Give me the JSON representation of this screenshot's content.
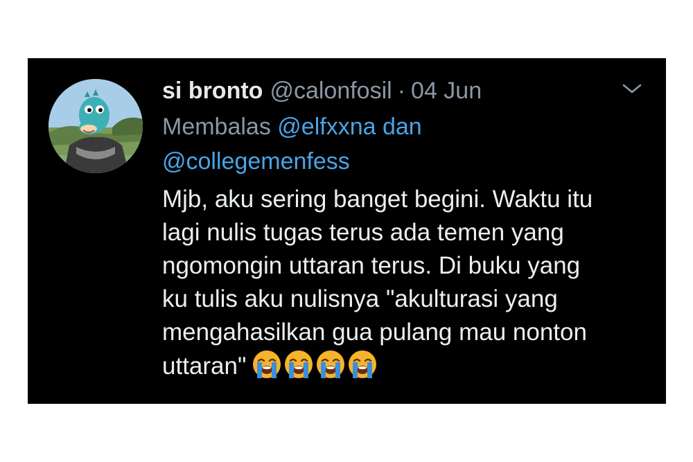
{
  "tweet": {
    "display_name": "si bronto",
    "handle": "@calonfosil",
    "separator": "·",
    "date": "04 Jun",
    "reply_prefix": "Membalas",
    "reply_mention_1": "@elfxxna dan",
    "reply_mention_2": "@collegemenfess",
    "body_lines": [
      "Mjb, aku sering banget begini. Waktu itu",
      "lagi nulis tugas terus ada temen yang",
      "ngomongin uttaran terus. Di buku yang",
      "ku tulis aku nulisnya \"akulturasi yang",
      "mengahasilkan gua pulang mau nonton",
      "uttaran\""
    ],
    "emojis": [
      "loudly-crying-face",
      "loudly-crying-face",
      "loudly-crying-face",
      "loudly-crying-face"
    ]
  },
  "colors": {
    "background": "#000000",
    "primary_text": "#e7e9ea",
    "secondary_text": "#8b98a5",
    "link": "#4aa4e6",
    "emoji_face": "#f7b32b",
    "emoji_tears": "#3b8fd9"
  }
}
